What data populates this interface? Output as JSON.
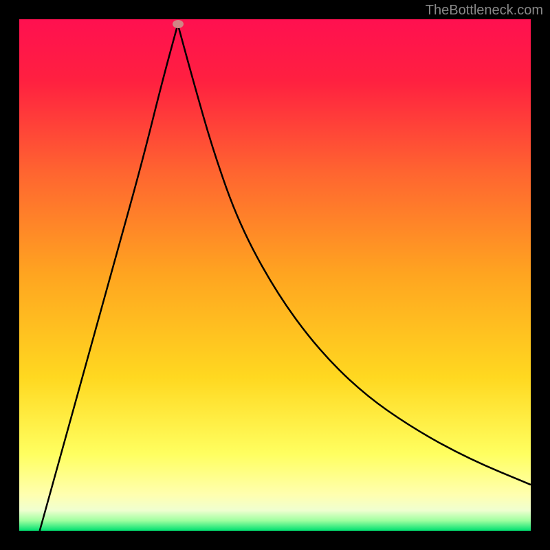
{
  "watermark": "TheBottleneck.com",
  "chart_data": {
    "type": "line",
    "title": "",
    "xlabel": "",
    "ylabel": "",
    "xlim": [
      0,
      100
    ],
    "ylim": [
      0,
      100
    ],
    "gradient_colors": {
      "top": "#ff0040",
      "upper_mid": "#ff6030",
      "mid": "#ffb020",
      "lower_mid": "#ffff60",
      "near_bottom": "#ffffc0",
      "bottom": "#00e060"
    },
    "curve": {
      "description": "V-shaped bottleneck curve representing mismatch percentage. Steeply descends from top-left, reaches minimum near x=31, then rises with decreasing slope toward upper-right.",
      "minimum_point": {
        "x": 31,
        "y": 99
      },
      "left_branch": [
        {
          "x": 4,
          "y": 0
        },
        {
          "x": 9,
          "y": 18
        },
        {
          "x": 14,
          "y": 36
        },
        {
          "x": 19,
          "y": 54
        },
        {
          "x": 24,
          "y": 72
        },
        {
          "x": 28,
          "y": 88
        },
        {
          "x": 31,
          "y": 99
        }
      ],
      "right_branch": [
        {
          "x": 31,
          "y": 99
        },
        {
          "x": 34,
          "y": 88
        },
        {
          "x": 38,
          "y": 74
        },
        {
          "x": 43,
          "y": 60
        },
        {
          "x": 50,
          "y": 47
        },
        {
          "x": 58,
          "y": 36
        },
        {
          "x": 67,
          "y": 27
        },
        {
          "x": 77,
          "y": 20
        },
        {
          "x": 88,
          "y": 14
        },
        {
          "x": 100,
          "y": 9
        }
      ]
    },
    "marker": {
      "x": 31,
      "y": 99,
      "color": "#d08585"
    }
  }
}
